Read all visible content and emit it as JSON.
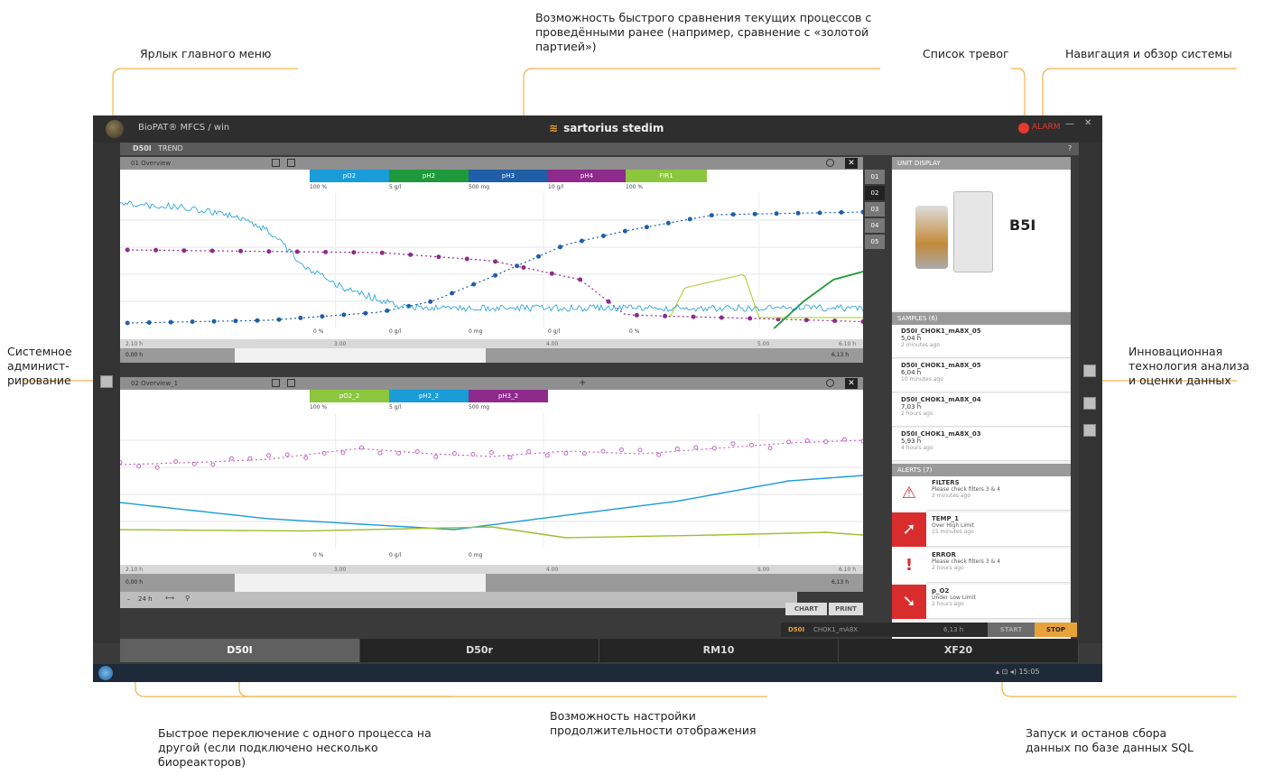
{
  "annotations": {
    "main_menu": "Ярлык главного меню",
    "compare_lines": [
      "Возможность быстрого сравнения текущих процессов с",
      "проведёнными ранее (например, сравнение с «золотой",
      "партией»)"
    ],
    "alarm_list": "Список тревог",
    "navigation": "Навигация и обзор системы",
    "sysadmin_lines": [
      "Системное",
      "админист-",
      "рирование"
    ],
    "innovative_lines": [
      "Инновационная",
      "технология анализа",
      "и оценки данных"
    ],
    "duration_lines": [
      "Возможность настройки",
      "продолжительности отображения"
    ],
    "switch_lines": [
      "Быстрое переключение с одного процесса на",
      "другой (если подключено несколько",
      "биореакторов)"
    ],
    "sql_lines": [
      "Запуск и останов сбора",
      "данных по базе данных SQL"
    ]
  },
  "app": {
    "title": "BioPAT® MFCS / win",
    "brand": "sartorius stedim",
    "alarm_label": "ALARM",
    "min": "—",
    "close": "✕"
  },
  "breadcrumb": {
    "unit": "D50I",
    "view": "TREND"
  },
  "help": "?",
  "chart1": {
    "title": "01 Overview",
    "legend": [
      {
        "label": "pO2",
        "color": "#1a9cd8",
        "unit": "100 %"
      },
      {
        "label": "pH2",
        "color": "#1e9a3c",
        "unit": "5 g/l"
      },
      {
        "label": "pH3",
        "color": "#1f5fa8",
        "unit": "500 mg"
      },
      {
        "label": "pH4",
        "color": "#8e2a8c",
        "unit": "10 g/l"
      },
      {
        "label": "FIR1",
        "color": "#8cc63f",
        "unit": "100 %"
      }
    ],
    "zero_labels": [
      "0 %",
      "0 g/l",
      "0 mg",
      "0 g/l",
      "0 %"
    ],
    "time_ticks": [
      "2.10 h",
      "3.00",
      "4.00",
      "5.00",
      "6.10 h"
    ],
    "nav_left": "0,00 h",
    "nav_right": "6,13 h"
  },
  "chart2": {
    "title": "02 Overview_1",
    "legend": [
      {
        "label": "pO2_2",
        "color": "#8cc63f",
        "unit": "100 %"
      },
      {
        "label": "pH2_2",
        "color": "#1a9cd8",
        "unit": "5 g/l"
      },
      {
        "label": "pH3_2",
        "color": "#8e2a8c",
        "unit": "500 mg"
      }
    ],
    "zero_labels": [
      "0 %",
      "0 g/l",
      "0 mg"
    ],
    "time_ticks": [
      "2.10 h",
      "3.00",
      "4.00",
      "5.00",
      "6.10 h"
    ],
    "nav_left": "0,00 h",
    "nav_right": "6,13 h",
    "add": "+"
  },
  "sidenums": [
    "01",
    "02",
    "03",
    "04",
    "05"
  ],
  "unit_display": {
    "header": "UNIT DISPLAY",
    "name": "B5I"
  },
  "samples": {
    "header": "SAMPLES (6)",
    "items": [
      {
        "name": "D50I_CHOK1_mA8X_05",
        "value": "5,04 h",
        "time": "2 minutes ago"
      },
      {
        "name": "D50I_CHOK1_mA8X_05",
        "value": "6,04 h",
        "time": "10 minutes ago"
      },
      {
        "name": "D50I_CHOK1_mA8X_04",
        "value": "7,03 h",
        "time": "2 hours ago"
      },
      {
        "name": "D50I_CHOK1_mA8X_03",
        "value": "5,93 h",
        "time": "4 hours ago"
      }
    ]
  },
  "alerts": {
    "header": "ALERTS (7)",
    "items": [
      {
        "icon": "⚠",
        "name": "FILTERS",
        "desc": "Please check filters 3 & 4",
        "time": "2 minutes ago",
        "red": false
      },
      {
        "icon": "➚",
        "name": "TEMP_1",
        "desc": "Over High Limit",
        "time": "15 minutes ago",
        "red": true
      },
      {
        "icon": "!",
        "name": "ERROR",
        "desc": "Please check filters 3 & 4",
        "time": "2 hours ago",
        "red": false
      },
      {
        "icon": "➘",
        "name": "p_O2",
        "desc": "Under Low Limit",
        "time": "2 hours ago",
        "red": true
      }
    ]
  },
  "buttons": {
    "chart": "CHART",
    "print": "PRINT",
    "start": "START",
    "stop": "STOP"
  },
  "bottom_left": {
    "duration": "24 h"
  },
  "status": {
    "unit": "D50I",
    "batch": "CHOK1_mA8X",
    "time": "6,13 h"
  },
  "process_tabs": [
    "D50I",
    "D50r",
    "RM10",
    "XF20"
  ],
  "tray_time": "15:05",
  "chart_series": {
    "blue_noisy": [
      [
        0,
        0.92
      ],
      [
        0.08,
        0.9
      ],
      [
        0.15,
        0.84
      ],
      [
        0.2,
        0.72
      ],
      [
        0.25,
        0.45
      ],
      [
        0.3,
        0.3
      ],
      [
        0.38,
        0.16
      ],
      [
        0.45,
        0.15
      ],
      [
        1,
        0.15
      ]
    ],
    "dot_blue": [
      [
        0.01,
        0.04
      ],
      [
        0.2,
        0.06
      ],
      [
        0.35,
        0.12
      ],
      [
        0.42,
        0.2
      ],
      [
        0.5,
        0.38
      ],
      [
        0.6,
        0.62
      ],
      [
        0.68,
        0.72
      ],
      [
        0.8,
        0.84
      ],
      [
        1,
        0.86
      ]
    ],
    "dot_purple": [
      [
        0.01,
        0.58
      ],
      [
        0.35,
        0.56
      ],
      [
        0.5,
        0.5
      ],
      [
        0.62,
        0.36
      ],
      [
        0.68,
        0.1
      ],
      [
        1,
        0.05
      ]
    ],
    "green_line": [
      [
        0.88,
        0
      ],
      [
        0.92,
        0.2
      ],
      [
        0.96,
        0.36
      ],
      [
        1,
        0.42
      ]
    ],
    "olive_step": [
      [
        0.74,
        0.08
      ],
      [
        0.76,
        0.3
      ],
      [
        0.84,
        0.4
      ],
      [
        0.86,
        0.08
      ],
      [
        1,
        0.08
      ]
    ],
    "c2_blue": [
      [
        0,
        0.34
      ],
      [
        0.2,
        0.22
      ],
      [
        0.45,
        0.14
      ],
      [
        0.62,
        0.26
      ],
      [
        0.75,
        0.35
      ],
      [
        0.9,
        0.5
      ],
      [
        1,
        0.54
      ]
    ],
    "c2_olive": [
      [
        0,
        0.14
      ],
      [
        0.25,
        0.13
      ],
      [
        0.5,
        0.16
      ],
      [
        0.6,
        0.08
      ],
      [
        0.8,
        0.1
      ],
      [
        0.95,
        0.12
      ],
      [
        1,
        0.1
      ]
    ],
    "c2_purple_dots": [
      [
        0,
        0.62
      ],
      [
        0.12,
        0.64
      ],
      [
        0.2,
        0.66
      ],
      [
        0.32,
        0.74
      ],
      [
        0.42,
        0.7
      ],
      [
        0.5,
        0.68
      ],
      [
        0.6,
        0.72
      ],
      [
        0.7,
        0.7
      ],
      [
        0.8,
        0.74
      ],
      [
        0.9,
        0.78
      ],
      [
        1,
        0.8
      ]
    ]
  }
}
